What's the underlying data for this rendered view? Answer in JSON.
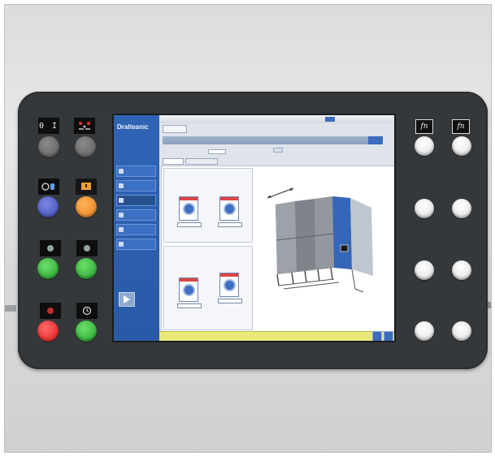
{
  "panel": {
    "left_keys": [
      {
        "label": "0 I",
        "knob": "grey"
      },
      {
        "label": "",
        "knob": "grey"
      },
      {
        "label": "",
        "knob": "blue"
      },
      {
        "label": "",
        "knob": "orange"
      },
      {
        "label": "",
        "knob": "green"
      },
      {
        "label": "",
        "knob": "green"
      },
      {
        "label": "",
        "knob": "red"
      },
      {
        "label": "",
        "knob": "green"
      }
    ],
    "fn_keys": [
      "fn",
      "fn"
    ],
    "colors": {
      "panel": "#34383a",
      "screen_sidebar": "#2f64b5",
      "status_bar": "#e9e97a"
    }
  },
  "screen": {
    "logo": "Dralteanic",
    "nav_items": [
      "",
      "",
      "",
      "",
      "",
      "",
      ""
    ],
    "topbar_title": "",
    "topbar_right": "",
    "tabs": [
      "",
      ""
    ],
    "status_text": ""
  }
}
